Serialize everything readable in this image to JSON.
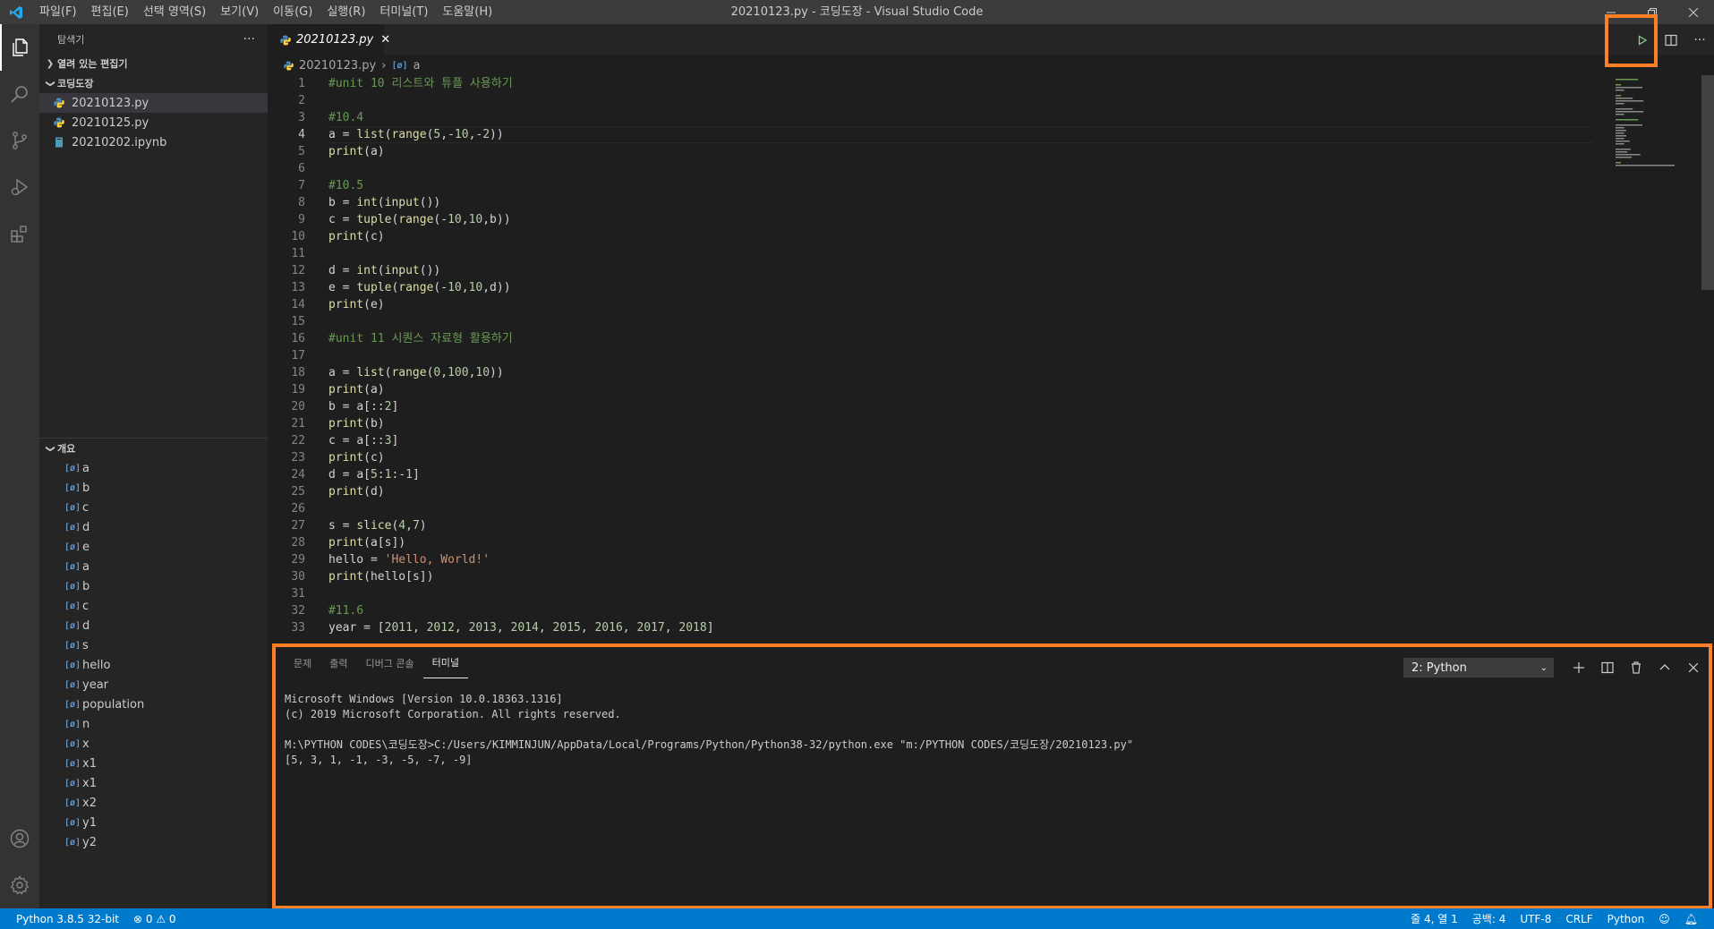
{
  "window": {
    "title": "20210123.py - 코딩도장 - Visual Studio Code",
    "menu": [
      "파일(F)",
      "편집(E)",
      "선택 영역(S)",
      "보기(V)",
      "이동(G)",
      "실행(R)",
      "터미널(T)",
      "도움말(H)"
    ]
  },
  "sidebar": {
    "header": "탐색기",
    "more": "···",
    "open_editors": "열려 있는 편집기",
    "folder": "코딩도장",
    "files": [
      {
        "name": "20210123.py"
      },
      {
        "name": "20210125.py"
      },
      {
        "name": "20210202.ipynb"
      }
    ],
    "outline_title": "개요",
    "symbols": [
      "a",
      "b",
      "c",
      "d",
      "e",
      "a",
      "b",
      "c",
      "d",
      "s",
      "hello",
      "year",
      "population",
      "n",
      "x",
      "x1",
      "x1",
      "x2",
      "y1",
      "y2"
    ]
  },
  "editor": {
    "tab": "20210123.py",
    "breadcrumb_file": "20210123.py",
    "breadcrumb_symbol": "a",
    "cursor_line": 4,
    "lines": [
      {
        "n": "1",
        "t": "#unit 10 리스트와 튜플 사용하기",
        "k": "com"
      },
      {
        "n": "2",
        "t": "",
        "k": "txt"
      },
      {
        "n": "3",
        "t": "#10.4",
        "k": "com"
      },
      {
        "n": "4",
        "t": "a = list(range(5,-10,-2))",
        "k": "code"
      },
      {
        "n": "5",
        "t": "print(a)",
        "k": "code"
      },
      {
        "n": "6",
        "t": "",
        "k": "txt"
      },
      {
        "n": "7",
        "t": "#10.5",
        "k": "com"
      },
      {
        "n": "8",
        "t": "b = int(input())",
        "k": "code"
      },
      {
        "n": "9",
        "t": "c = tuple(range(-10,10,b))",
        "k": "code"
      },
      {
        "n": "10",
        "t": "print(c)",
        "k": "code"
      },
      {
        "n": "11",
        "t": "",
        "k": "txt"
      },
      {
        "n": "12",
        "t": "d = int(input())",
        "k": "code"
      },
      {
        "n": "13",
        "t": "e = tuple(range(-10,10,d))",
        "k": "code"
      },
      {
        "n": "14",
        "t": "print(e)",
        "k": "code"
      },
      {
        "n": "15",
        "t": "",
        "k": "txt"
      },
      {
        "n": "16",
        "t": "#unit 11 시퀀스 자료형 활용하기",
        "k": "com"
      },
      {
        "n": "17",
        "t": "",
        "k": "txt"
      },
      {
        "n": "18",
        "t": "a = list(range(0,100,10))",
        "k": "code"
      },
      {
        "n": "19",
        "t": "print(a)",
        "k": "code"
      },
      {
        "n": "20",
        "t": "b = a[::2]",
        "k": "code"
      },
      {
        "n": "21",
        "t": "print(b)",
        "k": "code"
      },
      {
        "n": "22",
        "t": "c = a[::3]",
        "k": "code"
      },
      {
        "n": "23",
        "t": "print(c)",
        "k": "code"
      },
      {
        "n": "24",
        "t": "d = a[5:1:-1]",
        "k": "code"
      },
      {
        "n": "25",
        "t": "print(d)",
        "k": "code"
      },
      {
        "n": "26",
        "t": "",
        "k": "txt"
      },
      {
        "n": "27",
        "t": "s = slice(4,7)",
        "k": "code"
      },
      {
        "n": "28",
        "t": "print(a[s])",
        "k": "code"
      },
      {
        "n": "29",
        "t": "hello = 'Hello, World!'",
        "k": "code"
      },
      {
        "n": "30",
        "t": "print(hello[s])",
        "k": "code"
      },
      {
        "n": "31",
        "t": "",
        "k": "txt"
      },
      {
        "n": "32",
        "t": "#11.6",
        "k": "com"
      },
      {
        "n": "33",
        "t": "year = [2011, 2012, 2013, 2014, 2015, 2016, 2017, 2018]",
        "k": "code"
      }
    ]
  },
  "panel": {
    "tabs": [
      "문제",
      "출력",
      "디버그 콘솔",
      "터미널"
    ],
    "active_tab": "터미널",
    "terminal_select": "2: Python",
    "terminal_lines": [
      "Microsoft Windows [Version 10.0.18363.1316]",
      "(c) 2019 Microsoft Corporation. All rights reserved.",
      "",
      "M:\\PYTHON CODES\\코딩도장>C:/Users/KIMMINJUN/AppData/Local/Programs/Python/Python38-32/python.exe \"m:/PYTHON CODES/코딩도장/20210123.py\"",
      "[5, 3, 1, -1, -3, -5, -7, -9]"
    ]
  },
  "statusbar": {
    "interpreter": "Python 3.8.5 32-bit",
    "problems": "⊗ 0 ⚠ 0",
    "position": "줄 4, 열 1",
    "spaces": "공백: 4",
    "encoding": "UTF-8",
    "eol": "CRLF",
    "language": "Python"
  },
  "colors": {
    "accent": "#007acc",
    "highlight_box": "#ff7f27",
    "run_icon": "#89d185"
  }
}
